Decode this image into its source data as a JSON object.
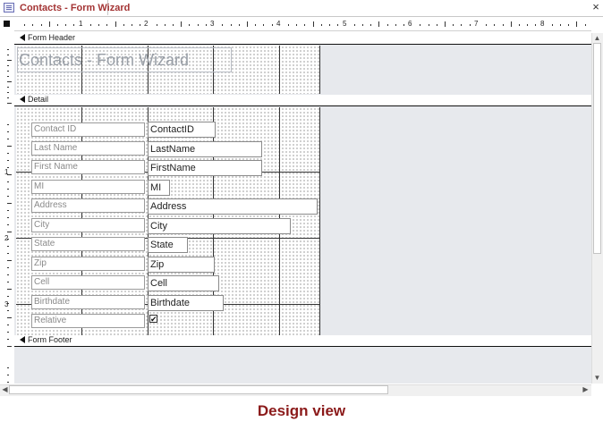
{
  "window": {
    "tab_title": "Contacts - Form Wizard",
    "close_glyph": "×",
    "icon": "form-icon"
  },
  "ruler": {
    "numbers": [
      "1",
      "2",
      "3",
      "4",
      "5",
      "6",
      "7",
      "8"
    ],
    "vertical_numbers": [
      "1",
      "2",
      "3"
    ]
  },
  "sections": {
    "form_header": "Form Header",
    "detail": "Detail",
    "form_footer": "Form Footer"
  },
  "header": {
    "title": "Contacts - Form Wizard"
  },
  "fields": [
    {
      "label": "Contact ID",
      "control": "ContactID"
    },
    {
      "label": "Last Name",
      "control": "LastName"
    },
    {
      "label": "First Name",
      "control": "FirstName"
    },
    {
      "label": "MI",
      "control": "MI"
    },
    {
      "label": "Address",
      "control": "Address"
    },
    {
      "label": "City",
      "control": "City"
    },
    {
      "label": "State",
      "control": "State"
    },
    {
      "label": "Zip",
      "control": "Zip"
    },
    {
      "label": "Cell",
      "control": "Cell"
    },
    {
      "label": "Birthdate",
      "control": "Birthdate"
    },
    {
      "label": "Relative",
      "control": "",
      "checked": true
    }
  ],
  "checkbox_glyph": "✔",
  "caption": "Design view",
  "colors": {
    "tab_title": "#a33333",
    "caption": "#8b1a1a",
    "section_background": "#e7e9ed"
  }
}
